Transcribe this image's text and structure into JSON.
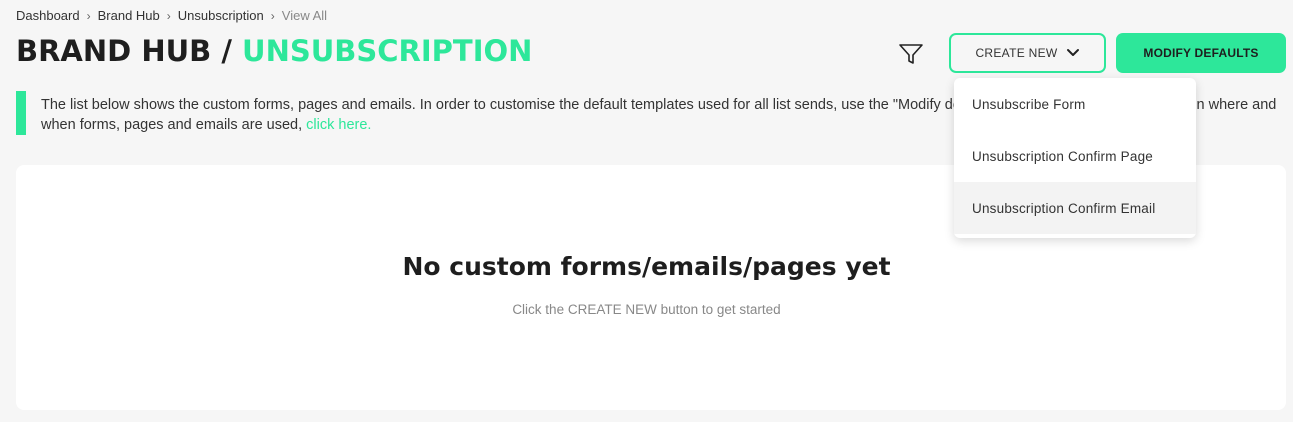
{
  "breadcrumb": {
    "items": [
      "Dashboard",
      "Brand Hub",
      "Unsubscription",
      "View All"
    ]
  },
  "header": {
    "title_prefix": "BRAND HUB / ",
    "title_accent": "UNSUBSCRIPTION",
    "filter_icon": "filter-icon",
    "create_label": "CREATE NEW",
    "modify_label": "MODIFY DEFAULTS"
  },
  "info": {
    "text": "The list below shows the custom forms, pages and emails. In order to customise the default templates used for all list sends, use the \"Modify defaults\" button to the right. For more on where and when forms, pages and emails are used, ",
    "link": "click here."
  },
  "empty": {
    "title": "No custom forms/emails/pages yet",
    "subtitle": "Click the CREATE NEW button to get started"
  },
  "dropdown": {
    "items": [
      "Unsubscribe Form",
      "Unsubscription Confirm Page",
      "Unsubscription Confirm Email"
    ]
  },
  "colors": {
    "accent": "#2de79a",
    "background": "#f6f6f6",
    "card": "#ffffff"
  }
}
